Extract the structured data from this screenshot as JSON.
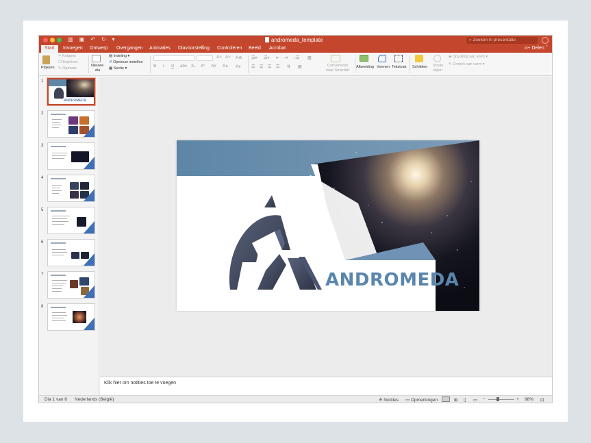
{
  "window": {
    "title": "andromeda_template",
    "search_placeholder": "Zoeken in presentatie"
  },
  "tabs": [
    "Start",
    "Invoegen",
    "Ontwerp",
    "Overgangen",
    "Animaties",
    "Diavoorstelling",
    "Controleren",
    "Beeld",
    "Acrobat"
  ],
  "share_label": "Delen",
  "ribbon": {
    "plakken": "Plakken",
    "knippen": "Knippen",
    "kopieren": "Kopiëren",
    "opmaak": "Opmaak",
    "nieuwe_dia_1": "Nieuwe",
    "nieuwe_dia_2": "dia",
    "indeling": "Indeling",
    "opnieuw": "Opnieuw instellen",
    "sectie": "Sectie",
    "converteren_1": "Converteren",
    "converteren_2": "naar SmartArt",
    "afbeelding": "Afbeelding",
    "vormen": "Vormen",
    "tekstvak": "Tekstvak",
    "schikken": "Schikken",
    "snelle_1": "Snelle",
    "snelle_2": "stijlen",
    "opvulling": "Opvulling van vorm",
    "omtrek": "Omtrek van vorm"
  },
  "slide_numbers": [
    "1",
    "2",
    "3",
    "4",
    "5",
    "6",
    "7",
    "8"
  ],
  "slide_title": "ANDROMEDA",
  "notes_placeholder": "Klik hier om notities toe te voegen",
  "status": {
    "slide_pos": "Dia 1 van 8",
    "language": "Nederlands (België)",
    "notes": "Notities",
    "comments": "Opmerkingen",
    "zoom": "98%"
  },
  "colors": {
    "accent": "#c4472d",
    "slide_blue": "#5f87a7",
    "logo_dark": "#3e4456"
  }
}
